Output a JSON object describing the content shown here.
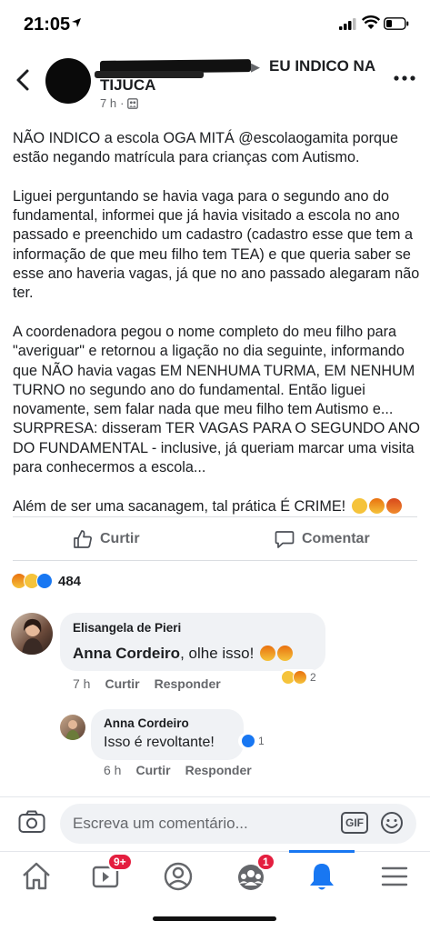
{
  "status_bar": {
    "time": "21:05"
  },
  "post": {
    "group_name_line1": "EU INDICO NA",
    "group_name_line2": "TIJUCA",
    "time": "7 h",
    "paragraphs": [
      "NÃO INDICO a escola OGA MITÁ @escolaogamita porque estão negando matrícula para crianças com Autismo.",
      "Liguei perguntando se havia vaga para o segundo ano do fundamental, informei que já havia visitado a escola no ano passado e preenchido um cadastro (cadastro esse que tem a informação de que meu filho tem TEA) e que queria saber se esse ano haveria vagas, já que no ano passado alegaram não ter.",
      "A coordenadora pegou o nome completo do meu filho para \"averiguar\" e retornou a ligação no dia seguinte, informando que NÃO havia vagas EM NENHUMA TURMA, EM NENHUM TURNO no segundo ano do fundamental. Então liguei novamente, sem falar nada que meu filho tem Autismo e... SURPRESA: disseram TER VAGAS PARA O SEGUNDO ANO DO FUNDAMENTAL - inclusive, já queriam marcar uma visita para conhecermos a escola...",
      "Além de ser uma sacanagem, tal prática É CRIME!"
    ],
    "reaction_count": "484"
  },
  "actions": {
    "like_label": "Curtir",
    "comment_label": "Comentar"
  },
  "comments": [
    {
      "author": "Elisangela de Pieri",
      "mention": "Anna Cordeiro",
      "text": ", olhe isso!",
      "time": "7 h",
      "like_label": "Curtir",
      "reply_label": "Responder",
      "reaction_count": "2"
    },
    {
      "author": "Anna Cordeiro",
      "text": "Isso é revoltante!",
      "time": "6 h",
      "like_label": "Curtir",
      "reply_label": "Responder",
      "reaction_count": "1"
    }
  ],
  "composer": {
    "placeholder": "Escreva um comentário...",
    "gif_label": "GIF"
  },
  "nav": {
    "watch_badge": "9+",
    "groups_badge": "1",
    "active_tab": "notifications"
  },
  "colors": {
    "accent": "#1877f2",
    "badge": "#e41e3f",
    "secondary_text": "#65676b"
  }
}
